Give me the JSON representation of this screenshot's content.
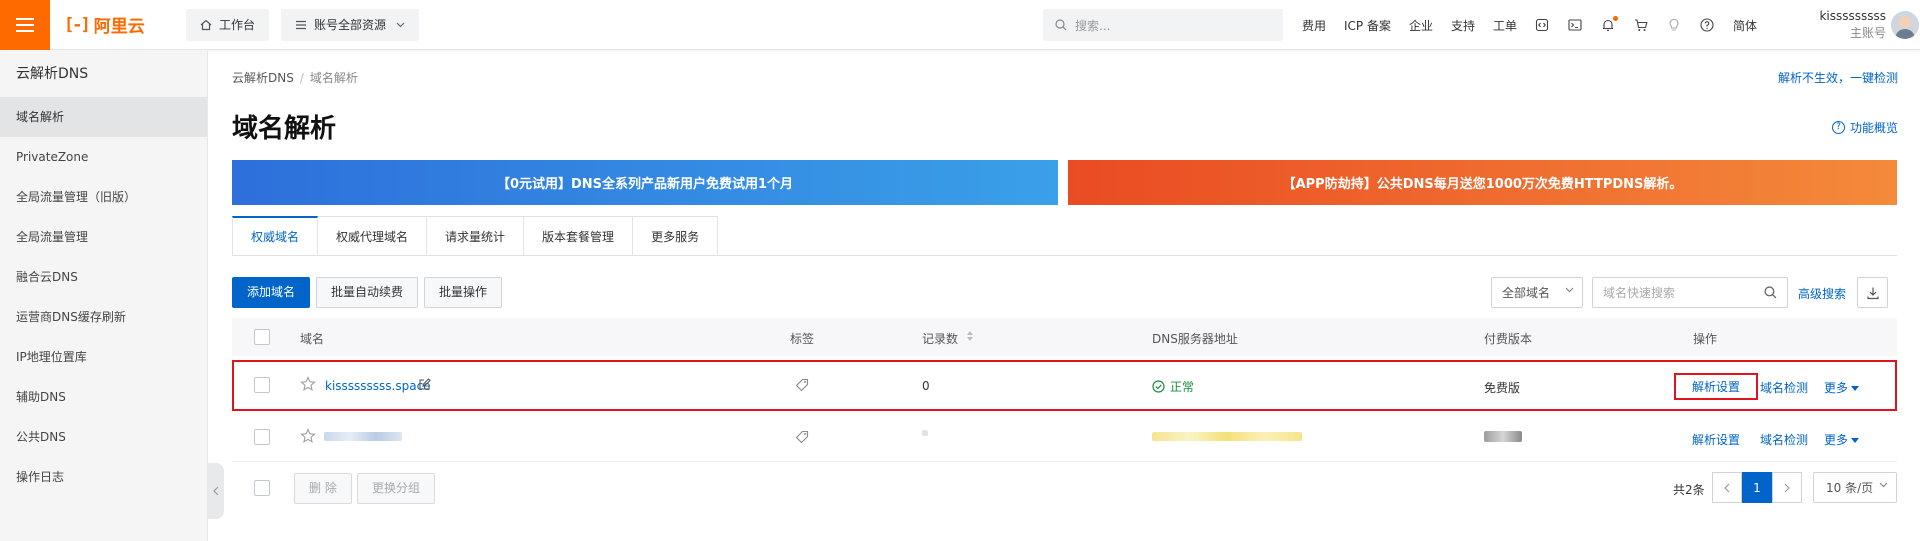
{
  "header": {
    "logo_mark": "[-]",
    "logo_text": "阿里云",
    "workbench": "工作台",
    "resource_scope": "账号全部资源",
    "search_placeholder": "搜索...",
    "links": [
      "费用",
      "ICP 备案",
      "企业",
      "支持",
      "工单"
    ],
    "language": "简体",
    "username": "kisssssssss",
    "role": "主账号"
  },
  "sidebar": {
    "title": "云解析DNS",
    "items": [
      {
        "label": "域名解析",
        "active": true
      },
      {
        "label": "PrivateZone"
      },
      {
        "label": "全局流量管理（旧版）"
      },
      {
        "label": "全局流量管理"
      },
      {
        "label": "融合云DNS"
      },
      {
        "label": "运营商DNS缓存刷新"
      },
      {
        "label": "IP地理位置库"
      },
      {
        "label": "辅助DNS"
      },
      {
        "label": "公共DNS"
      },
      {
        "label": "操作日志"
      }
    ]
  },
  "main": {
    "breadcrumb": [
      "云解析DNS",
      "域名解析"
    ],
    "breadcrumb_sep": "/",
    "quick_link": "解析不生效，一键检测",
    "title": "域名解析",
    "overview_link": "功能概览",
    "banners": [
      {
        "text": "【0元试用】DNS全系列产品新用户免费试用1个月",
        "color": "#2d6fdb"
      },
      {
        "text": "【APP防劫持】公共DNS每月送您1000万次免费HTTPDNS解析。",
        "color": "#ea4b23"
      }
    ],
    "tabs": [
      "权威域名",
      "权威代理域名",
      "请求量统计",
      "版本套餐管理",
      "更多服务"
    ],
    "toolbar": {
      "add": "添加域名",
      "renew": "批量自动续费",
      "batch": "批量操作",
      "scope": "全部域名",
      "search_placeholder": "域名快速搜索",
      "advanced": "高级搜索"
    }
  },
  "table": {
    "columns": [
      "域名",
      "标签",
      "记录数",
      "DNS服务器地址",
      "付费版本",
      "操作"
    ],
    "rows": [
      {
        "domain": "kisssssssss.space",
        "records": "0",
        "dns_status": "正常",
        "plan": "免费版",
        "actions": [
          "解析设置",
          "域名检测",
          "更多"
        ]
      },
      {
        "domain": "",
        "records": "",
        "dns_status": "",
        "plan": "",
        "actions": [
          "解析设置",
          "域名检测",
          "更多"
        ]
      }
    ]
  },
  "footer": {
    "delete": "删 除",
    "change_group": "更换分组",
    "total": "共2条",
    "current_page": "1",
    "page_size": "10 条/页"
  },
  "colors": {
    "accent": "#0064c8",
    "brand": "#ff6a00",
    "highlight": "#e0141c",
    "ok": "#1e8e3e"
  }
}
